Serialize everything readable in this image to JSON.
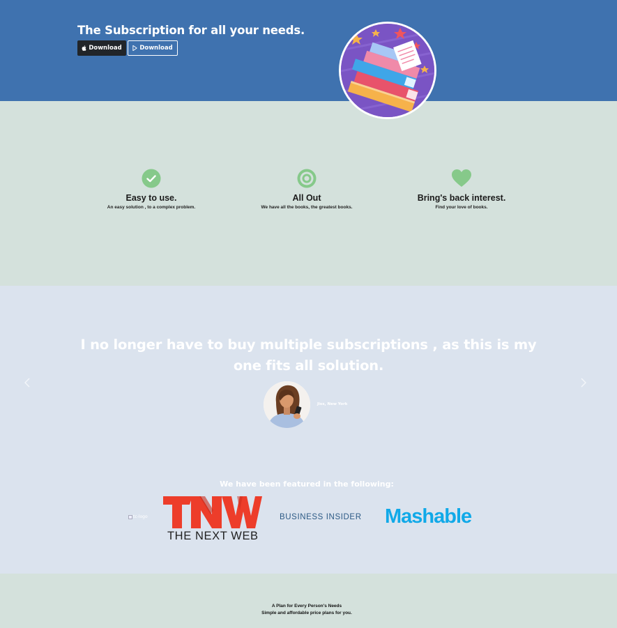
{
  "hero": {
    "title": "The Subscription for all your needs.",
    "download_ios_label": "Download",
    "download_android_label": "Download",
    "colors": {
      "background": "#3f72af",
      "dark_button": "#212529"
    }
  },
  "features": [
    {
      "icon": "check-circle-icon",
      "title": "Easy to use.",
      "description": "An easy solution , to a complex problem."
    },
    {
      "icon": "target-icon",
      "title": "All Out",
      "description": "We have all the books, the greatest books."
    },
    {
      "icon": "heart-icon",
      "title": "Bring's back interest.",
      "description": "Find your love of books."
    }
  ],
  "testimonial": {
    "quote": "I no longer have to buy multiple subscriptions , as this is my one fits all solution.",
    "author": "Jiss, New York",
    "prev_icon": "chevron-left-icon",
    "next_icon": "chevron-right-icon"
  },
  "featured": {
    "title": "We have been featured in the following:",
    "broken_image_alt": "tc-logo",
    "logos": {
      "tnw_big": "TNW",
      "tnw_sub": "THE NEXT WEB",
      "business_insider": "BUSINESS INSIDER",
      "mashable": "Mashable"
    },
    "colors": {
      "tnw": "#ed3d2a",
      "mashable": "#10a9e8",
      "business_insider": "#2c5a85"
    }
  },
  "pricing": {
    "title": "A Plan for Every Person's Needs",
    "subtitle": "Simple and affordable price plans for you."
  },
  "colors": {
    "feature_icon": "#86c98a",
    "section_green": "#d4e1dc",
    "section_blue": "#dbe3ee"
  }
}
